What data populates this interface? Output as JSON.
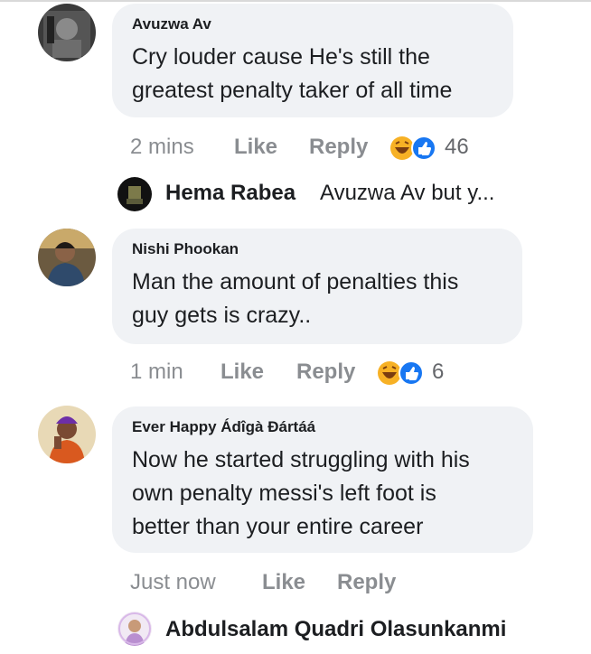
{
  "comments": [
    {
      "author": "Avuzwa Av",
      "text_lines": [
        "Cry louder cause He's still the",
        "greatest penalty taker of all time"
      ],
      "time": "2 mins",
      "like": "Like",
      "reply": "Reply",
      "reactions": [
        "haha",
        "like"
      ],
      "reaction_count": "46"
    },
    {
      "author": "Nishi Phookan",
      "text_lines": [
        "Man the amount of penalties this",
        "guy gets is crazy.."
      ],
      "time": "1 min",
      "like": "Like",
      "reply": "Reply",
      "reactions": [
        "haha",
        "like"
      ],
      "reaction_count": "6"
    },
    {
      "author": "Ever Happy Ádîgà Ðártáá",
      "text_lines": [
        "Now he started struggling with his",
        "own penalty messi's  left foot is",
        "better than your entire career"
      ],
      "time": "Just now",
      "like": "Like",
      "reply": "Reply"
    }
  ],
  "reply_preview": {
    "name": "Hema Rabea",
    "snippet": "Avuzwa Av but y..."
  },
  "bottom_reply": {
    "name": "Abdulsalam Quadri Olasunkanmi"
  },
  "colors": {
    "bubble": "#f0f2f5",
    "meta_text": "#8a8d91",
    "haha": "#f7b125",
    "like_blue": "#1877f2"
  }
}
